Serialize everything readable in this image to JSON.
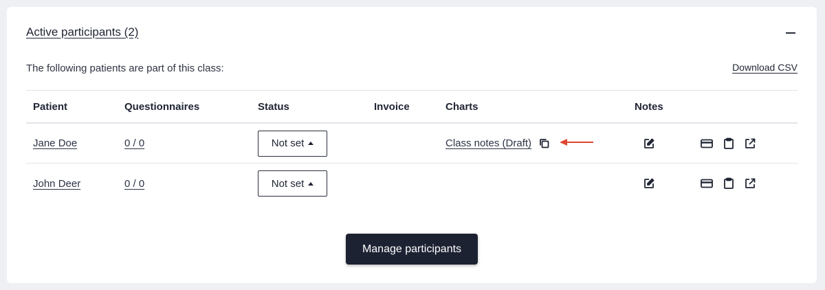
{
  "section": {
    "title": "Active participants (2)",
    "intro": "The following patients are part of this class:",
    "download_label": "Download CSV"
  },
  "table": {
    "headers": {
      "patient": "Patient",
      "questionnaires": "Questionnaires",
      "status": "Status",
      "invoice": "Invoice",
      "charts": "Charts",
      "notes": "Notes"
    },
    "rows": [
      {
        "patient": "Jane Doe",
        "questionnaires": "0 / 0",
        "status": "Not set",
        "invoice": "",
        "chart": "Class notes (Draft)"
      },
      {
        "patient": "John Deer",
        "questionnaires": "0 / 0",
        "status": "Not set",
        "invoice": "",
        "chart": ""
      }
    ]
  },
  "manage_label": "Manage participants",
  "icons": {
    "collapse": "minus-icon",
    "copy": "copy-icon",
    "annotation": "arrow-left-icon",
    "note": "edit-note-icon",
    "invoice": "credit-card-icon",
    "clipboard": "clipboard-icon",
    "open": "external-link-icon"
  },
  "colors": {
    "accent": "#1d2233",
    "annotation_arrow": "#e0452e"
  }
}
